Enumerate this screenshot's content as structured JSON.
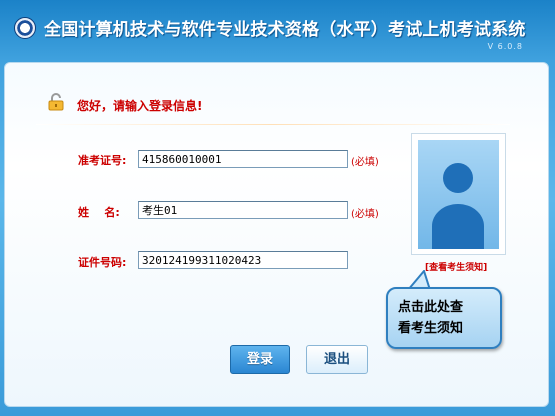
{
  "header": {
    "title": "全国计算机技术与软件专业技术资格（水平）考试上机考试系统",
    "version": "V 6.0.8"
  },
  "login": {
    "greeting": "您好，请输入登录信息!",
    "fields": [
      {
        "label": "准考证号:",
        "value": "415860010001",
        "required": "(必填)"
      },
      {
        "label": "姓    名:",
        "value": "考生01",
        "required": "(必填)"
      },
      {
        "label": "证件号码:",
        "value": "320124199311020423"
      }
    ]
  },
  "photo": {
    "notice_link": "[查看考生须知]"
  },
  "tooltip": {
    "text_line1": "点击此处查",
    "text_line2": "看考生须知"
  },
  "buttons": {
    "login_label": "登录",
    "exit_label": "退出"
  },
  "colors": {
    "accent_red": "#cc0000",
    "primary_blue": "#2a86d2",
    "header_bg": "#1b82c8"
  }
}
